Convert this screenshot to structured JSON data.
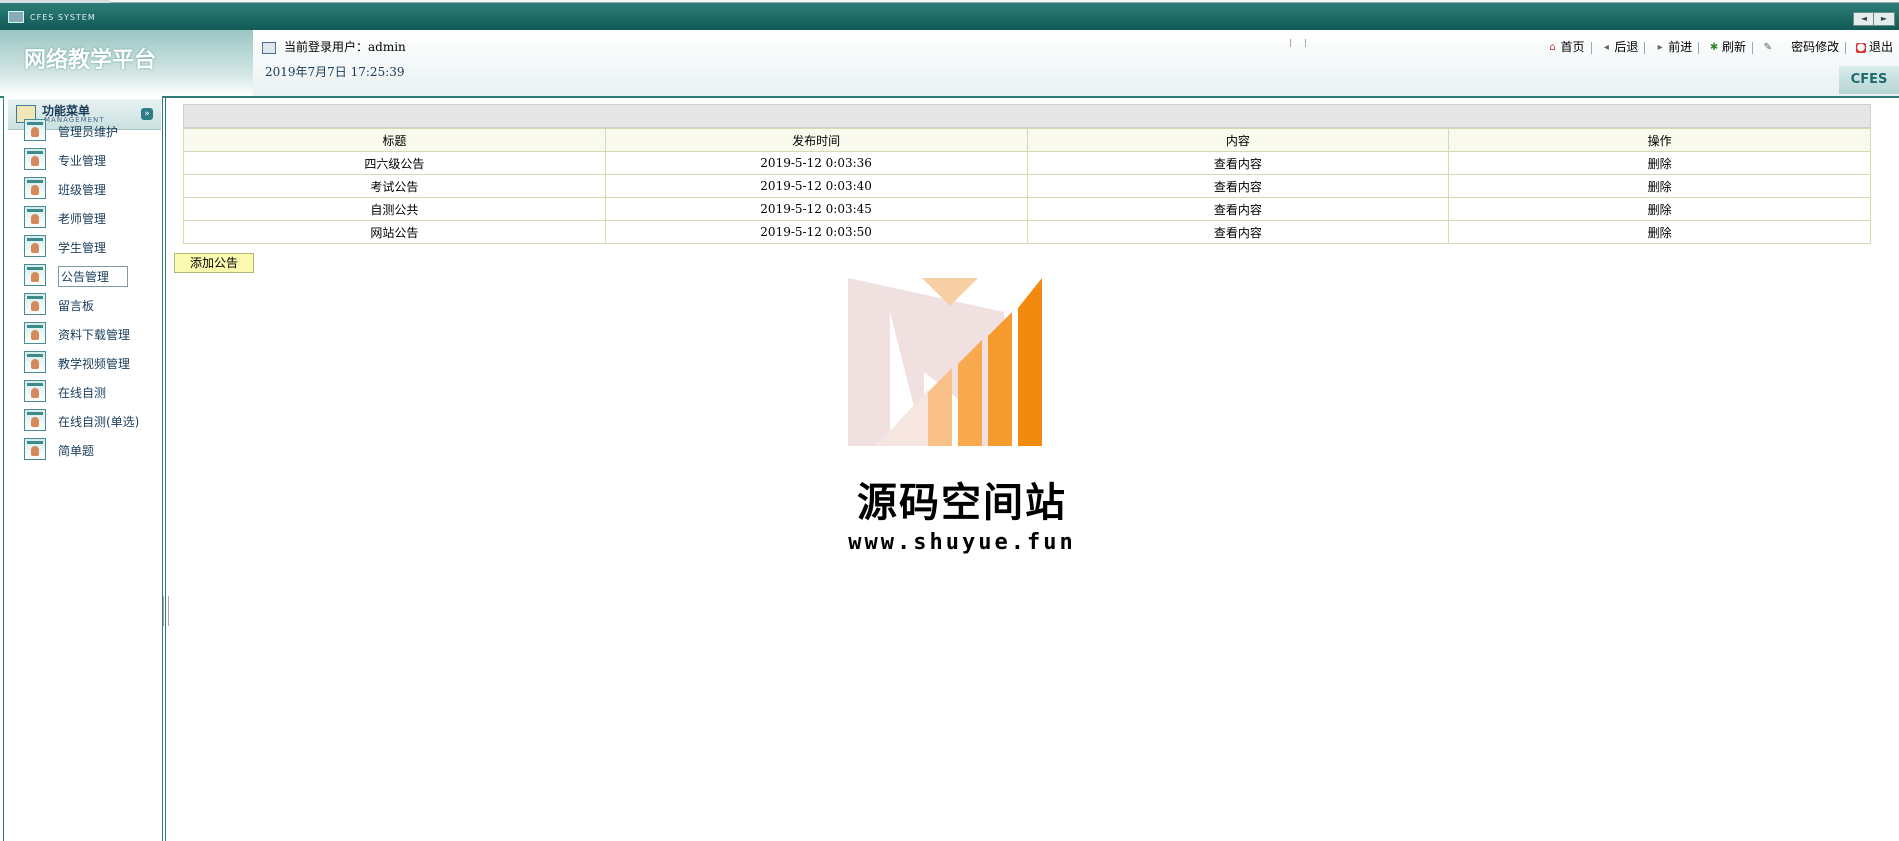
{
  "window": {
    "system_title": "CFES SYSTEM",
    "nav_left": "◄",
    "nav_right": "►"
  },
  "header": {
    "app_title": "网络教学平台",
    "current_user_label": "当前登录用户：admin",
    "datetime": "2019年7月7日 17:25:39",
    "brand_tag": "CFES",
    "toolbar": {
      "home": "首页",
      "back": "后退",
      "forward": "前进",
      "refresh": "刷新",
      "change_password": "密码修改",
      "logout": "退出"
    }
  },
  "sidebar": {
    "header_title": "功能菜单",
    "header_subtitle": "MANAGEMENT",
    "items": [
      {
        "label": "管理员维护"
      },
      {
        "label": "专业管理"
      },
      {
        "label": "班级管理"
      },
      {
        "label": "老师管理"
      },
      {
        "label": "学生管理"
      },
      {
        "label": "公告管理"
      },
      {
        "label": "留言板"
      },
      {
        "label": "资料下载管理"
      },
      {
        "label": "教学视频管理"
      },
      {
        "label": "在线自测"
      },
      {
        "label": "在线自测(单选)"
      },
      {
        "label": "简单题"
      }
    ]
  },
  "table": {
    "columns": [
      "标题",
      "发布时间",
      "内容",
      "操作"
    ],
    "rows": [
      {
        "title": "四六级公告",
        "time": "2019-5-12 0:03:36",
        "content": "查看内容",
        "action": "删除"
      },
      {
        "title": "考试公告",
        "time": "2019-5-12 0:03:40",
        "content": "查看内容",
        "action": "删除"
      },
      {
        "title": "自测公共",
        "time": "2019-5-12 0:03:45",
        "content": "查看内容",
        "action": "删除"
      },
      {
        "title": "网站公告",
        "time": "2019-5-12 0:03:50",
        "content": "查看内容",
        "action": "删除"
      }
    ]
  },
  "add_button": "添加公告",
  "watermark": {
    "title": "源码空间站",
    "url": "www.shuyue.fun"
  },
  "colors": {
    "accent": "#2f7c77",
    "table_header_bg": "#f9f9ee",
    "add_button_bg": "#fafab0",
    "watermark_orange": "#f38a10"
  }
}
